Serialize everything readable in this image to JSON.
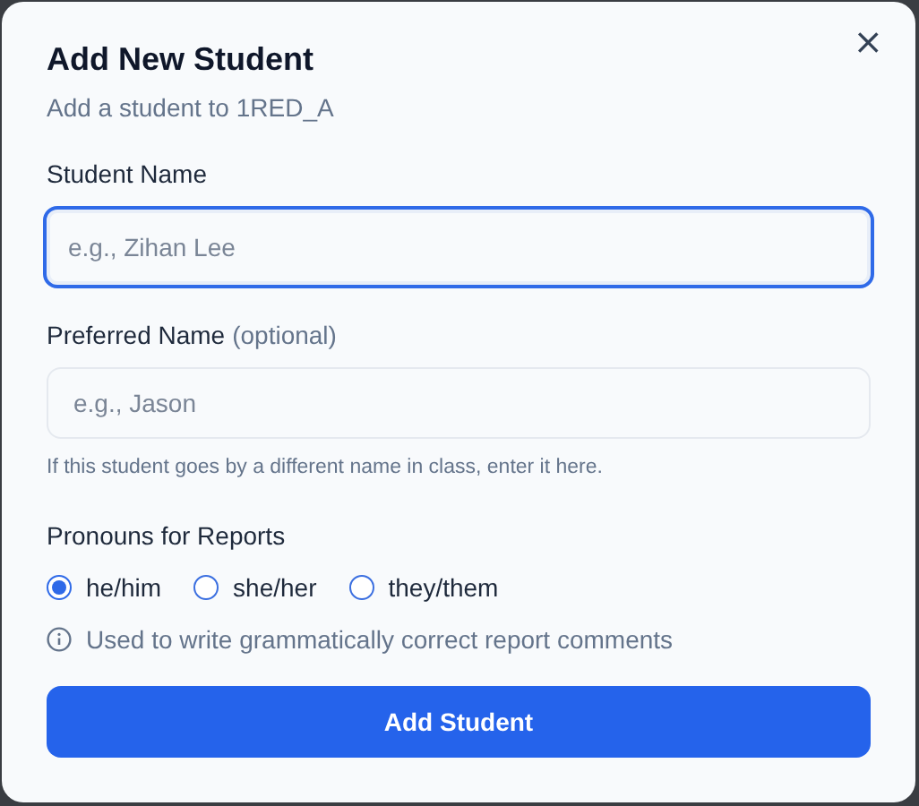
{
  "dialog": {
    "title": "Add New Student",
    "subtitle": "Add a student to 1RED_A",
    "close_icon": "×"
  },
  "fields": [
    {
      "label": "Student Name",
      "placeholder": "e.g., Zihan Lee",
      "focused": true
    },
    {
      "label": "Preferred Name",
      "optional_note": "(optional)",
      "placeholder": "e.g., Jason",
      "focused": false,
      "hint": "If this student goes by a different name in class, enter it here."
    }
  ],
  "pronouns": {
    "label": "Pronouns for Reports",
    "options": [
      {
        "label": "he/him",
        "selected": true
      },
      {
        "label": "she/her",
        "selected": false
      },
      {
        "label": "they/them",
        "selected": false
      }
    ],
    "note": "Used to write grammatically correct report comments"
  },
  "submit_button": "Add Student"
}
